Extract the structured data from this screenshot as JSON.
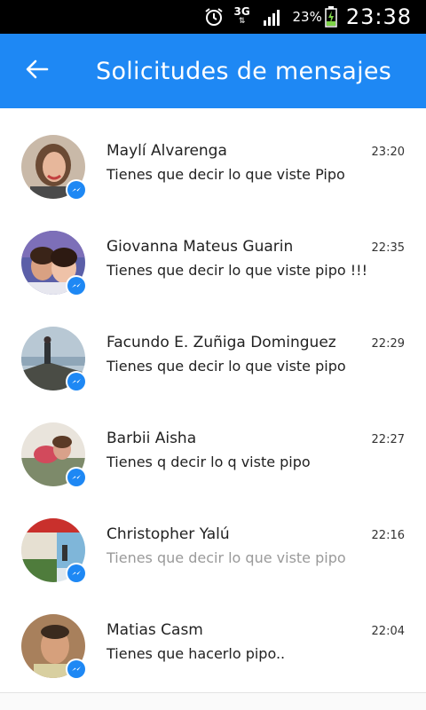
{
  "status_bar": {
    "alarm_icon": "alarm-clock-icon",
    "network_type": "3G",
    "network_arrows": "⇅",
    "signal_icon": "signal-bars-icon",
    "battery_percent": "23%",
    "battery_icon": "charging-battery-icon",
    "time": "23:38"
  },
  "app_bar": {
    "back_icon": "back-arrow-icon",
    "title": "Solicitudes de mensajes",
    "color": "#1e88f4"
  },
  "requests": [
    {
      "name": "Maylí Alvarenga",
      "preview": "Tienes que decir lo que viste Pipo",
      "time": "23:20",
      "read": false
    },
    {
      "name": "Giovanna Mateus Guarin",
      "preview": "Tienes que decir lo que viste pipo !!!",
      "time": "22:35",
      "read": false
    },
    {
      "name": "Facundo E. Zuñiga Dominguez",
      "preview": "Tienes que decir lo que viste pipo",
      "time": "22:29",
      "read": false
    },
    {
      "name": "Barbii Aisha",
      "preview": "Tienes q decir lo q viste pipo",
      "time": "22:27",
      "read": false
    },
    {
      "name": "Christopher Yalú",
      "preview": "Tienes que decir lo que viste pipo",
      "time": "22:16",
      "read": true
    },
    {
      "name": "Matias Casm",
      "preview": "Tienes que hacerlo pipo..",
      "time": "22:04",
      "read": false
    }
  ],
  "badge_icon": "messenger-bolt-icon"
}
